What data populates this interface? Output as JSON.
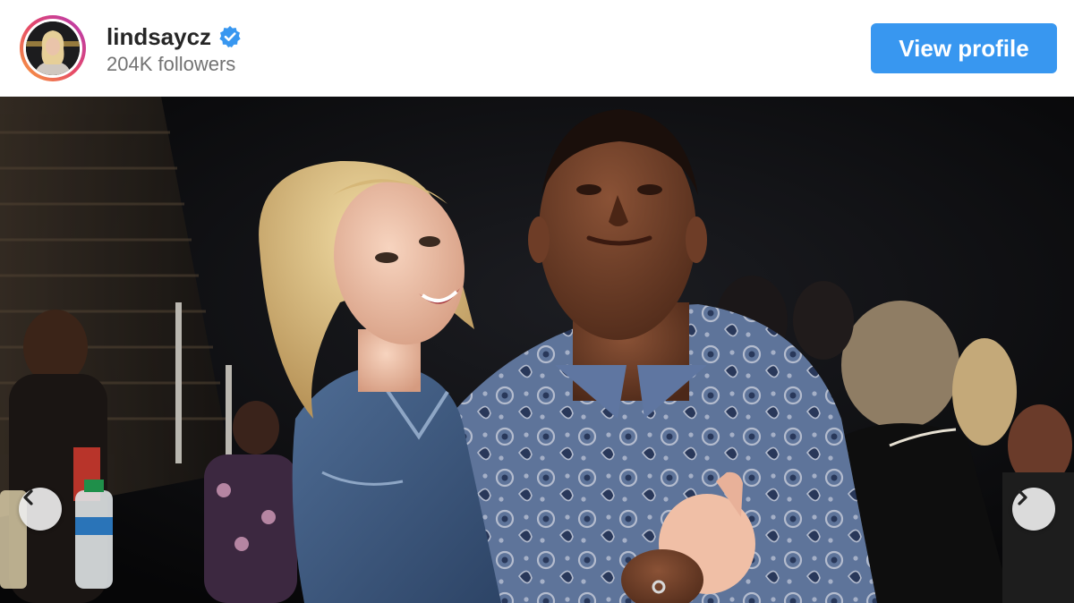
{
  "profile": {
    "username": "lindsaycz",
    "followers": "204K followers",
    "verified": true,
    "avatar_icon": "profile-photo",
    "verified_icon": "verified-badge-icon"
  },
  "actions": {
    "view_profile_label": "View profile"
  },
  "carousel": {
    "prev_icon": "chevron-left-icon",
    "next_icon": "chevron-right-icon"
  },
  "colors": {
    "button_blue": "#3897f0",
    "verified_blue": "#3897f0",
    "username_text": "#262626",
    "secondary_text": "#737373"
  }
}
